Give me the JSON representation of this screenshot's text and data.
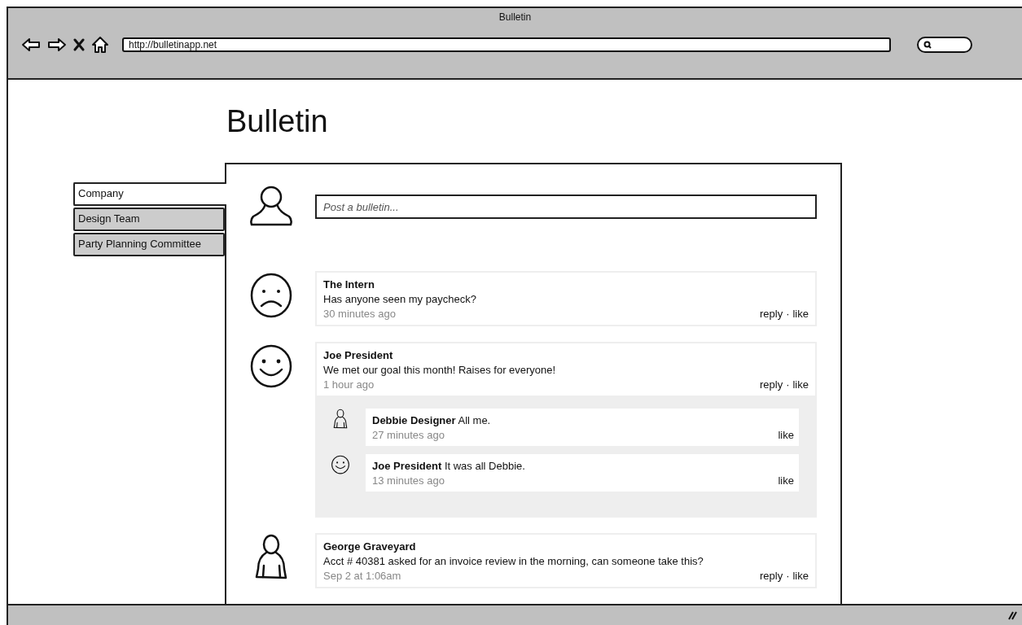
{
  "window": {
    "title": "Bulletin"
  },
  "browser": {
    "url": "http://bulletinapp.net"
  },
  "page": {
    "heading": "Bulletin"
  },
  "tabs": [
    {
      "label": "Company",
      "selected": true
    },
    {
      "label": "Design Team",
      "selected": false
    },
    {
      "label": "Party Planning Committee",
      "selected": false
    }
  ],
  "composer": {
    "avatar": {
      "kind": "person-outline"
    },
    "placeholder": "Post a bulletin..."
  },
  "posts": [
    {
      "avatar": {
        "kind": "sad-face"
      },
      "author": "The Intern",
      "text": "Has anyone seen my paycheck?",
      "time": "30 minutes ago",
      "actions": [
        "reply",
        "like"
      ],
      "separator": "·"
    },
    {
      "avatar": {
        "kind": "happy-face"
      },
      "author": "Joe President",
      "text": "We met our goal this month! Raises for everyone!",
      "time": "1 hour ago",
      "actions": [
        "reply",
        "like"
      ],
      "separator": "·",
      "replies": [
        {
          "avatar": {
            "kind": "person"
          },
          "author": "Debbie Designer",
          "text": "All me.",
          "time": "27 minutes ago",
          "actions": [
            "like"
          ]
        },
        {
          "avatar": {
            "kind": "happy-face"
          },
          "author": "Joe President",
          "text": "It was all Debbie.",
          "time": "13 minutes ago",
          "actions": [
            "like"
          ]
        }
      ]
    },
    {
      "avatar": {
        "kind": "person"
      },
      "author": "George Graveyard",
      "text": "Acct # 40381 asked for an invoice review in the morning, can someone take this?",
      "time": "Sep 2 at 1:06am",
      "actions": [
        "reply",
        "like"
      ],
      "separator": "·"
    }
  ]
}
